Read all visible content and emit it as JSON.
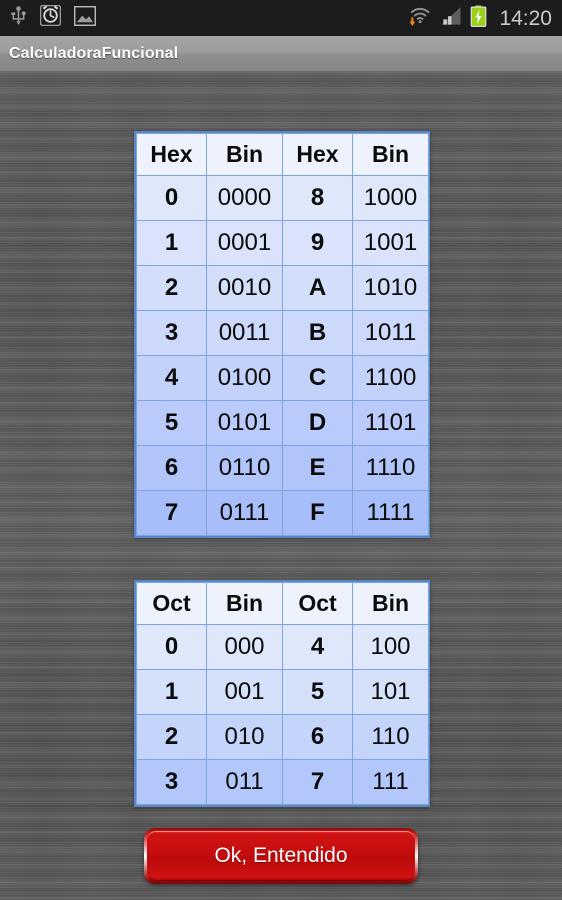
{
  "statusbar": {
    "icons_left": [
      "usb-icon",
      "alarm-clock-icon",
      "gallery-image-icon"
    ],
    "icons_right": [
      "wifi-download-icon",
      "signal-bars-icon",
      "battery-charging-icon"
    ],
    "clock": "14:20"
  },
  "titlebar": {
    "title": "CalculadoraFuncional"
  },
  "hex_table": {
    "headers": [
      "Hex",
      "Bin",
      "Hex",
      "Bin"
    ],
    "rows": [
      [
        "0",
        "0000",
        "8",
        "1000"
      ],
      [
        "1",
        "0001",
        "9",
        "1001"
      ],
      [
        "2",
        "0010",
        "A",
        "1010"
      ],
      [
        "3",
        "0011",
        "B",
        "1011"
      ],
      [
        "4",
        "0100",
        "C",
        "1100"
      ],
      [
        "5",
        "0101",
        "D",
        "1101"
      ],
      [
        "6",
        "0110",
        "E",
        "1110"
      ],
      [
        "7",
        "0111",
        "F",
        "1111"
      ]
    ]
  },
  "oct_table": {
    "headers": [
      "Oct",
      "Bin",
      "Oct",
      "Bin"
    ],
    "rows": [
      [
        "0",
        "000",
        "4",
        "100"
      ],
      [
        "1",
        "001",
        "5",
        "101"
      ],
      [
        "2",
        "010",
        "6",
        "110"
      ],
      [
        "3",
        "011",
        "7",
        "111"
      ]
    ]
  },
  "button": {
    "label": "Ok, Entendido"
  },
  "colors": {
    "accent_red": "#c40c0c",
    "table_border": "#5a86c8",
    "table_header_bg": "#eef2fd",
    "row_light": "#dfe7fb",
    "row_dark": "#a7befb",
    "background_metal": "#595959",
    "statusbar_bg": "#1c1c1c",
    "titlebar_bg": "#9c9c9c"
  }
}
